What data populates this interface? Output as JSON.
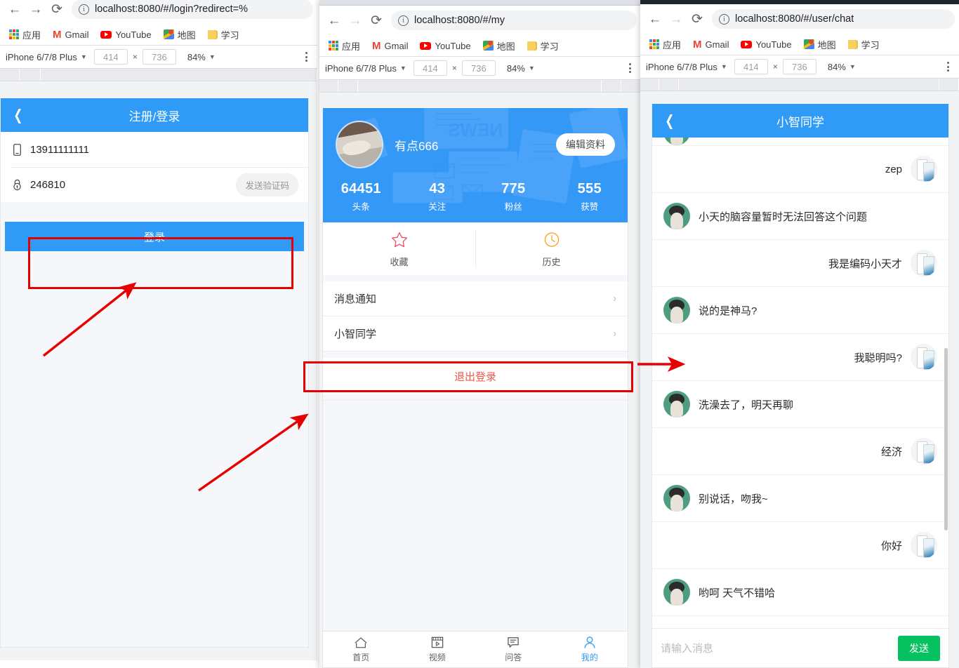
{
  "colors": {
    "accent": "#2f9bf6",
    "profile_hero": "#3498f7",
    "annotation_red": "#e60000",
    "logout_red": "#f2594b",
    "send_green": "#06c160",
    "star_red": "#e8525f",
    "clock_orange": "#f5a623"
  },
  "bookmarks": [
    {
      "name": "apps-grid-icon",
      "label": "应用"
    },
    {
      "name": "gmail-icon",
      "label": "Gmail"
    },
    {
      "name": "youtube-icon",
      "label": "YouTube"
    },
    {
      "name": "maps-icon",
      "label": "地图"
    },
    {
      "name": "folder-icon",
      "label": "学习"
    }
  ],
  "device_toolbar": {
    "device": "iPhone 6/7/8 Plus",
    "width": "414",
    "height": "736",
    "times": "×",
    "zoom": "84%",
    "caret": "▼"
  },
  "panels": [
    {
      "id": "login",
      "url_full": "localhost:8080/#/login?redirect=%",
      "url_host": "localhost:8080",
      "url_path": "/#/login?redirect=%",
      "page": {
        "appbar_title": "注册/登录",
        "back_icon": "chevron-left-icon",
        "fields": [
          {
            "icon": "phone-icon",
            "value": "13911111111"
          },
          {
            "icon": "lock-icon",
            "value": "246810",
            "action": "发送验证码"
          }
        ],
        "submit_label": "登录"
      }
    },
    {
      "id": "profile",
      "url_full": "localhost:8080/#/my",
      "url_host": "localhost:8080",
      "url_path": "/#/my",
      "page": {
        "username": "有点666",
        "edit_label": "编辑资料",
        "stats": [
          {
            "value": "64451",
            "label": "头条"
          },
          {
            "value": "43",
            "label": "关注"
          },
          {
            "value": "775",
            "label": "粉丝"
          },
          {
            "value": "555",
            "label": "获赞"
          }
        ],
        "quick": [
          {
            "icon": "star-icon",
            "label": "收藏"
          },
          {
            "icon": "clock-icon",
            "label": "历史"
          }
        ],
        "menu": [
          {
            "label": "消息通知",
            "chevron": "›"
          },
          {
            "label": "小智同学",
            "chevron": "›"
          }
        ],
        "logout_label": "退出登录",
        "tabs": [
          {
            "icon": "home-icon",
            "label": "首页",
            "active": false
          },
          {
            "icon": "video-icon",
            "label": "视频",
            "active": false
          },
          {
            "icon": "qa-icon",
            "label": "问答",
            "active": false
          },
          {
            "icon": "person-icon",
            "label": "我的",
            "active": true
          }
        ]
      }
    },
    {
      "id": "chat",
      "url_full": "localhost:8080/#/user/chat",
      "url_host": "localhost:8080",
      "url_path": "/#/user/chat",
      "page": {
        "appbar_title": "小智同学",
        "back_icon": "chevron-left-icon",
        "messages": [
          {
            "side": "bot",
            "text": "",
            "partial": true
          },
          {
            "side": "me",
            "text": "zep"
          },
          {
            "side": "bot",
            "text": "小天的脑容量暂时无法回答这个问题"
          },
          {
            "side": "me",
            "text": "我是编码小天才"
          },
          {
            "side": "bot",
            "text": "说的是神马?"
          },
          {
            "side": "me",
            "text": "我聪明吗?"
          },
          {
            "side": "bot",
            "text": "洗澡去了，明天再聊"
          },
          {
            "side": "me",
            "text": "经济"
          },
          {
            "side": "bot",
            "text": "别说话，吻我~"
          },
          {
            "side": "me",
            "text": "你好"
          },
          {
            "side": "bot",
            "text": "哟呵 天气不错哈"
          }
        ],
        "composer_placeholder": "请输入消息",
        "send_label": "发送"
      }
    }
  ]
}
